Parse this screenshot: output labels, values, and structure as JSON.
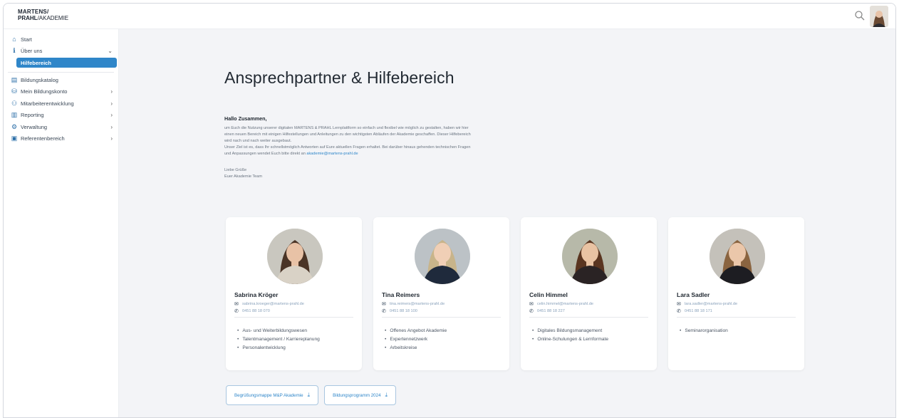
{
  "header": {
    "logo_line1": "MARTENS/",
    "logo_line2_bold": "PRAHL",
    "logo_line2_rest": "/AKADEMIE",
    "search_icon": "search-icon",
    "avatar_icon": "user-avatar"
  },
  "sidebar": {
    "items": [
      {
        "label": "Start",
        "icon": "home-icon"
      },
      {
        "label": "Über uns",
        "icon": "info-icon",
        "chevron": "⌄"
      },
      {
        "label": "Hilfebereich",
        "active": true
      },
      {
        "label": "Bildungskatalog",
        "icon": "catalog-icon"
      },
      {
        "label": "Mein Bildungskonto",
        "icon": "account-icon",
        "chevron": "›"
      },
      {
        "label": "Mitarbeiterentwicklung",
        "icon": "people-icon",
        "chevron": "›"
      },
      {
        "label": "Reporting",
        "icon": "chart-icon",
        "chevron": "›"
      },
      {
        "label": "Verwaltung",
        "icon": "admin-icon",
        "chevron": "›"
      },
      {
        "label": "Referentenbereich",
        "icon": "trainer-icon",
        "chevron": "›"
      }
    ]
  },
  "main": {
    "title": "Ansprechpartner & Hilfebereich",
    "greeting": "Hallo Zusammen,",
    "intro_lines": [
      "um Euch die Nutzung unserer digitalen MARTENS & PRAHL Lernplattform so einfach und flexibel wie möglich zu gestalten, haben wir hier",
      "einen neuen Bereich mit einigen Hilfestellungen und Anleitungen zu den wichtigsten Abläufen der Akademie geschaffen. Dieser Hilfebereich",
      "wird nach und nach weiter ausgebaut.",
      "Unser Ziel ist es, dass Ihr schnellstmöglich Antworten auf Eure aktuellen Fragen erhaltet. Bei darüber hinaus gehenden technischen Fragen"
    ],
    "intro_last_prefix": "und Anpassungen wendet Euch bitte direkt an ",
    "intro_link": "akademie@martens-prahl.de",
    "sign_1": "Liebe Grüße",
    "sign_2": "Euer Akademie Team",
    "contacts": [
      {
        "name": "Sabrina Kröger",
        "email": "sabrina.kroeger@martens-prahl.de",
        "phone": "0451 88 18 070",
        "topics": [
          "Aus- und Weiterbildungswesen",
          "Talentmanagement / Karriereplanung",
          "Personalentwicklung"
        ],
        "hair": "#4a3426",
        "skin": "#e8c2a6",
        "cloth": "#d9d2c6",
        "bg": "#c9c7bf"
      },
      {
        "name": "Tina Reimers",
        "email": "tina.reimers@martens-prahl.de",
        "phone": "0451 88 18 100",
        "topics": [
          "Offenes Angebot Akademie",
          "Expertennetzwerk",
          "Arbeitskreise"
        ],
        "hair": "#c8b48a",
        "skin": "#f0cfb6",
        "cloth": "#1f2a3c",
        "bg": "#bcc2c6"
      },
      {
        "name": "Celin Himmel",
        "email": "celin.himmel@martens-prahl.de",
        "phone": "0451 88 18 227",
        "topics": [
          "Digitales Bildungsmanagement",
          "Online-Schulungen & Lernformate"
        ],
        "hair": "#5a3520",
        "skin": "#e9c3a3",
        "cloth": "#2a2324",
        "bg": "#b7b9a9"
      },
      {
        "name": "Lara Sadler",
        "email": "lara.sadler@martens-prahl.de",
        "phone": "0451 88 18 171",
        "topics": [
          "Seminarorganisation"
        ],
        "hair": "#8a6440",
        "skin": "#ebc7aa",
        "cloth": "#1d1d22",
        "bg": "#c4c1ba"
      }
    ],
    "downloads": [
      {
        "label": "Begrüßungsmappe M&P Akademie",
        "icon": "download-icon"
      },
      {
        "label": "Bildungsprogramm 2024",
        "icon": "download-icon"
      }
    ]
  }
}
